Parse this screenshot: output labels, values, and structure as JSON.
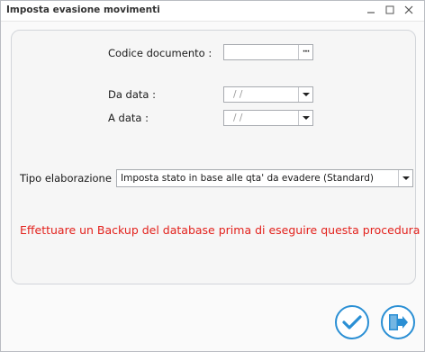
{
  "window": {
    "title": "Imposta evasione movimenti"
  },
  "form": {
    "codice_documento_label": "Codice documento :",
    "codice_documento_value": "",
    "da_data_label": "Da data :",
    "da_data_value": "/ /",
    "a_data_label": "A data :",
    "a_data_value": "/ /",
    "tipo_elaborazione_label": "Tipo elaborazione :",
    "tipo_elaborazione_value": "Imposta stato in base alle qta' da evadere (Standard)"
  },
  "warning": "Effettuare un Backup del database prima di eseguire questa procedura",
  "colors": {
    "warning": "#e3211c",
    "accent": "#2a8fd4"
  }
}
